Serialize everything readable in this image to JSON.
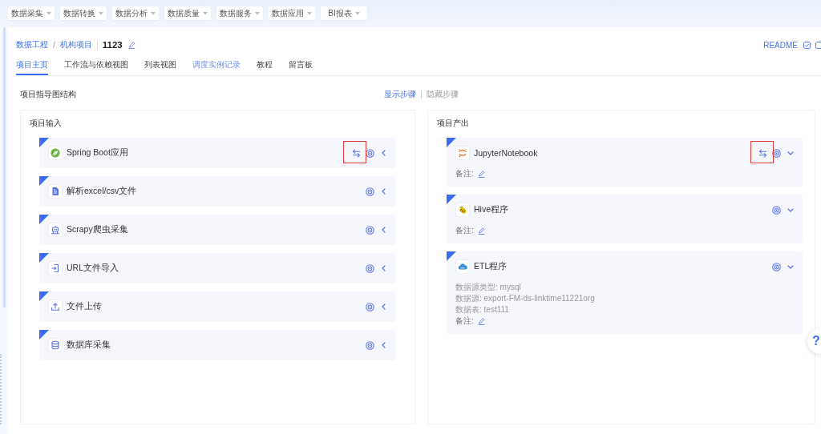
{
  "top_menu": [
    {
      "label": "数据采集"
    },
    {
      "label": "数据转换"
    },
    {
      "label": "数据分析"
    },
    {
      "label": "数据质量"
    },
    {
      "label": "数据服务"
    },
    {
      "label": "数据应用"
    },
    {
      "label": "BI报表"
    }
  ],
  "breadcrumb": {
    "links": [
      "数据工程",
      "机构项目"
    ],
    "separator": "/",
    "title": "1123"
  },
  "header_links": {
    "readme": "README"
  },
  "tabs": [
    {
      "label": "项目主页",
      "selected": true,
      "hovered": false
    },
    {
      "label": "工作流与依赖视图",
      "selected": false,
      "hovered": false
    },
    {
      "label": "列表视图",
      "selected": false,
      "hovered": false
    },
    {
      "label": "调度实例记录",
      "selected": false,
      "hovered": true
    },
    {
      "label": "教程",
      "selected": false,
      "hovered": false
    },
    {
      "label": "留言板",
      "selected": false,
      "hovered": false
    }
  ],
  "guide": {
    "title": "项目指导图结构",
    "steps": [
      {
        "label": "显示步骤",
        "selected": true
      },
      {
        "label": "隐藏步骤",
        "selected": false
      }
    ]
  },
  "inputs": {
    "title": "项目输入",
    "items": [
      {
        "name": "Spring Boot应用",
        "kind": "spring",
        "swap_button": true,
        "highlighted": true,
        "expanded": false
      },
      {
        "name": "解析excel/csv文件",
        "kind": "document",
        "swap_button": false,
        "highlighted": false,
        "expanded": false
      },
      {
        "name": "Scrapy爬虫采集",
        "kind": "robot",
        "swap_button": false,
        "highlighted": false,
        "expanded": false
      },
      {
        "name": "URL文件导入",
        "kind": "import",
        "swap_button": false,
        "highlighted": false,
        "expanded": false
      },
      {
        "name": "文件上传",
        "kind": "upload",
        "swap_button": false,
        "highlighted": false,
        "expanded": false
      },
      {
        "name": "数据库采集",
        "kind": "database",
        "swap_button": false,
        "highlighted": false,
        "expanded": false
      }
    ]
  },
  "outputs": {
    "title": "项目产出",
    "items": [
      {
        "name": "JupyterNotebook",
        "kind": "jupyter",
        "swap_button": true,
        "highlighted": true,
        "expanded": true,
        "note_label": "备注:"
      },
      {
        "name": "Hive程序",
        "kind": "hive",
        "swap_button": false,
        "highlighted": false,
        "expanded": true,
        "note_label": "备注:"
      },
      {
        "name": "ETL程序",
        "kind": "etl",
        "swap_button": false,
        "highlighted": false,
        "expanded": true,
        "details": [
          "数据源类型: mysql",
          "数据源: export-FM-ds-linktime11221org",
          "数据表: test111"
        ],
        "note_label": "备注:"
      }
    ]
  },
  "help_button": {
    "label": "?"
  }
}
